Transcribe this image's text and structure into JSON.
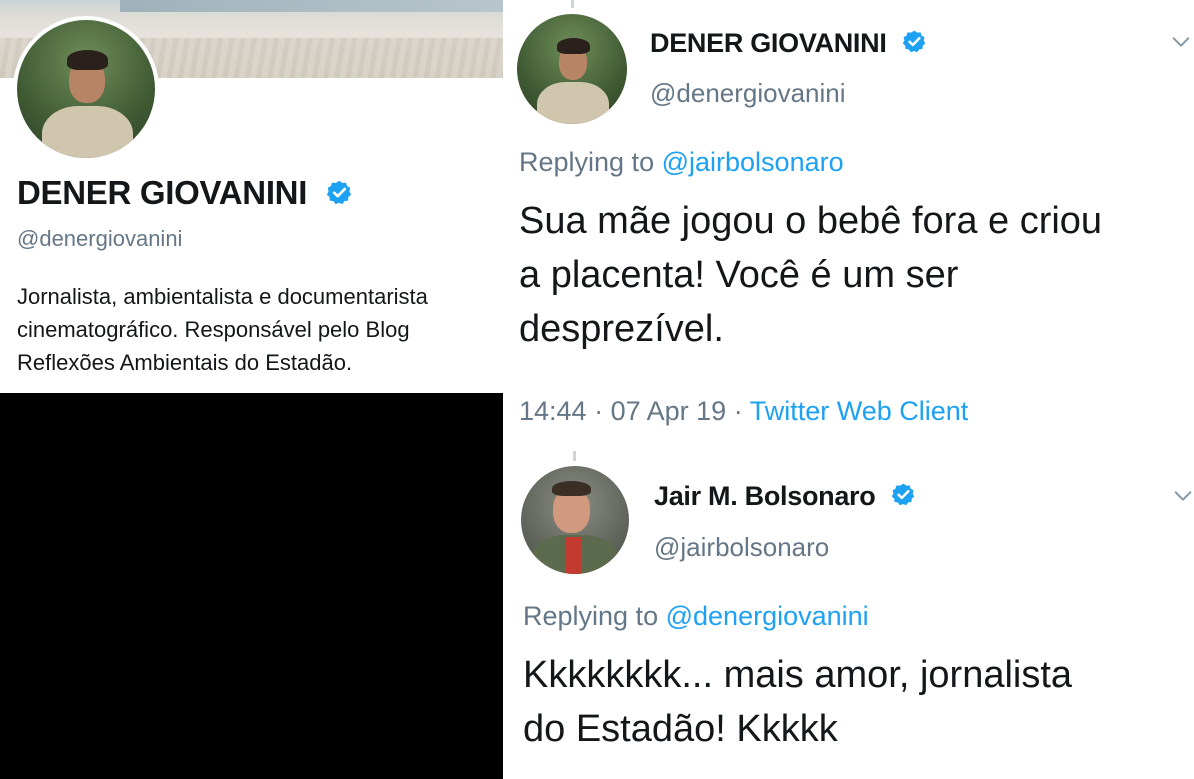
{
  "profile": {
    "name": "DENER GIOVANINI",
    "handle": "@denergiovanini",
    "bio_lines": [
      "Jornalista, ambientalista e documentarista",
      "cinematográfico. Responsável pelo Blog",
      "Reflexões Ambientais do Estadão."
    ]
  },
  "tweets": [
    {
      "author": "DENER GIOVANINI",
      "handle": "@denergiovanini",
      "replying_prefix": "Replying to",
      "replying_to": "@jairbolsonaro",
      "text_lines": [
        "Sua mãe jogou o bebê fora e criou",
        "a placenta! Você é um ser",
        "desprezível."
      ],
      "time": "14:44",
      "date": "07 Apr 19",
      "source": "Twitter Web Client"
    },
    {
      "author": "Jair M. Bolsonaro",
      "handle": "@jairbolsonaro",
      "replying_prefix": "Replying to",
      "replying_to": "@denergiovanini",
      "text_lines": [
        "Kkkkkkkk... mais amor, jornalista",
        "do Estadão! Kkkkk"
      ]
    }
  ],
  "separator": "·",
  "colors": {
    "link": "#1da1f2",
    "verified": "#1da1f2",
    "secondary_text": "#657786",
    "primary_text": "#14171a",
    "left_background": "#000000"
  },
  "icons": [
    "verified-badge-icon",
    "chevron-down-icon"
  ]
}
